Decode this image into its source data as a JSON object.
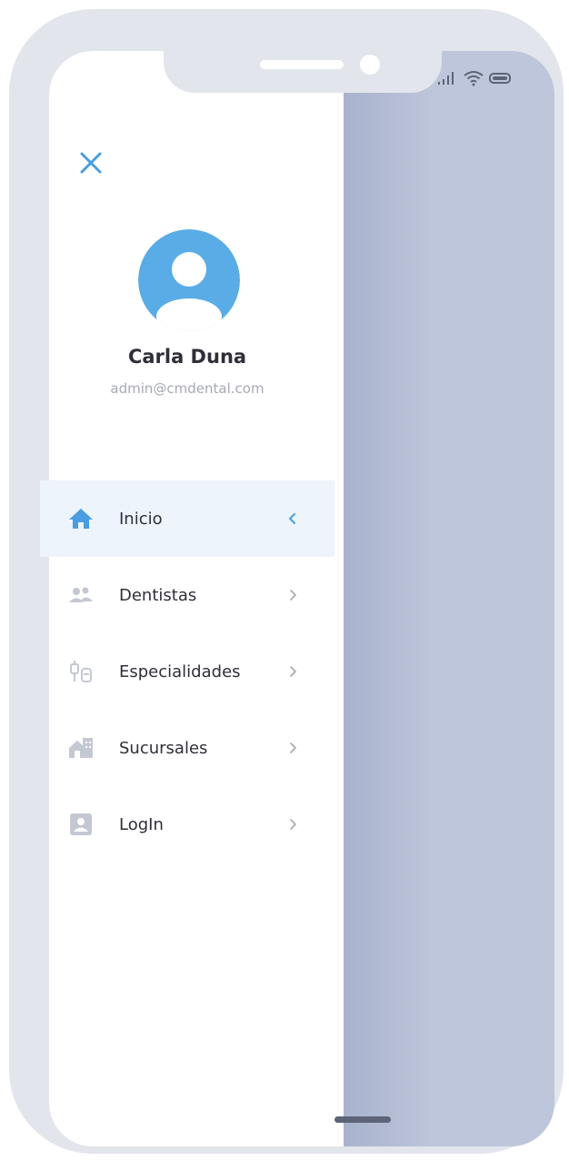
{
  "drawer": {
    "user": {
      "name": "Carla Duna",
      "email": "admin@cmdental.com"
    },
    "menu": [
      {
        "label": "Inicio",
        "icon": "home-icon",
        "active": true
      },
      {
        "label": "Dentistas",
        "icon": "users-icon",
        "active": false
      },
      {
        "label": "Especialidades",
        "icon": "dental-tools-icon",
        "active": false
      },
      {
        "label": "Sucursales",
        "icon": "branch-building-icon",
        "active": false
      },
      {
        "label": "LogIn",
        "icon": "user-card-icon",
        "active": false
      }
    ]
  },
  "colors": {
    "accent": "#4a9de0",
    "avatar": "#5aace6",
    "overlay": "#bec6db",
    "inactive_icon": "#c4c8d2",
    "active_bg": "#edf4fc"
  }
}
